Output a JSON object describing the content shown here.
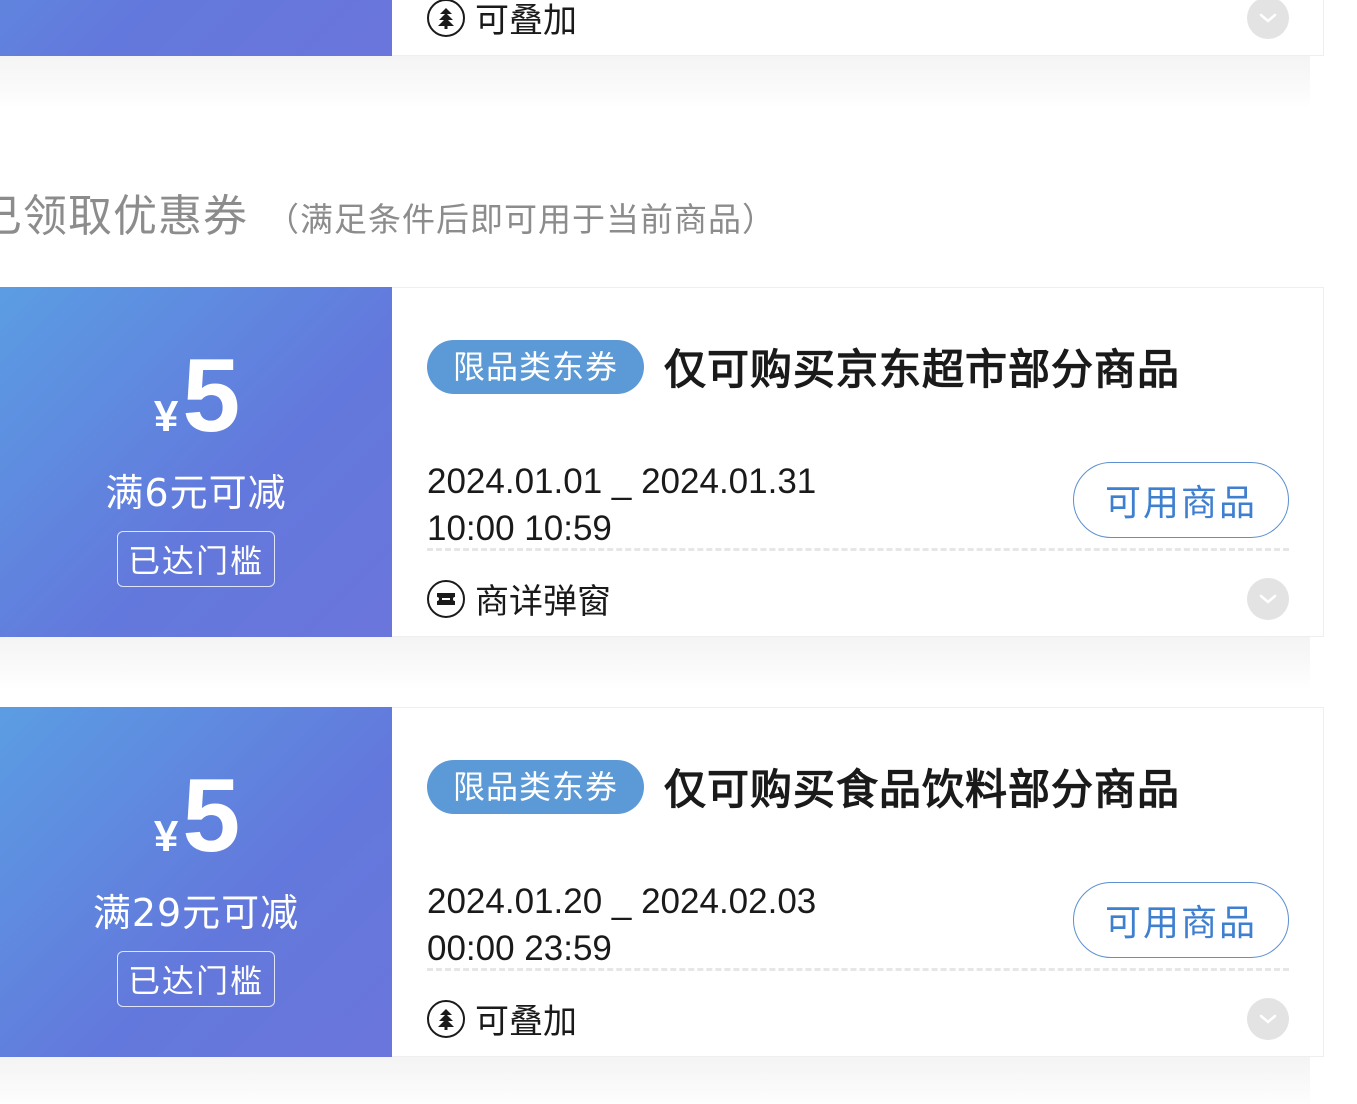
{
  "top_coupon": {
    "footer_label": "可叠加",
    "footer_icon": "stack-tree-icon",
    "chevron_icon": "chevron-down-icon"
  },
  "section": {
    "title": "已领取优惠券",
    "subtitle": "（满足条件后即可用于当前商品）"
  },
  "coupons": [
    {
      "currency": "¥",
      "amount": "5",
      "condition": "满6元可减",
      "threshold": "已达门槛",
      "tag": "限品类东券",
      "title": "仅可购买京东超市部分商品",
      "date_range": "2024.01.01 _ 2024.01.31",
      "time_range": "10:00 10:59",
      "button_label": "可用商品",
      "footer_label": "商详弹窗",
      "footer_icon": "ticket-icon"
    },
    {
      "currency": "¥",
      "amount": "5",
      "condition": "满29元可减",
      "threshold": "已达门槛",
      "tag": "限品类东券",
      "title": "仅可购买食品饮料部分商品",
      "date_range": "2024.01.20 _ 2024.02.03",
      "time_range": "00:00 23:59",
      "button_label": "可用商品",
      "footer_label": "可叠加",
      "footer_icon": "stack-tree-icon"
    }
  ],
  "colors": {
    "coupon_gradient_start": "#5b9de3",
    "coupon_gradient_end": "#6b76dc",
    "tag_bg": "#5b9ad6",
    "button_border": "#5b8fd0",
    "heading_gray": "#8c8c8c"
  }
}
